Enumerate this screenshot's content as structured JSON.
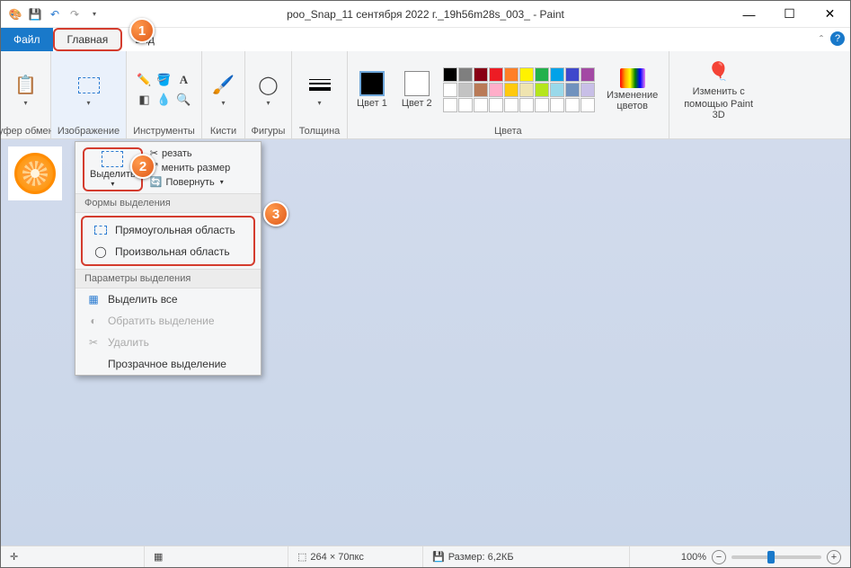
{
  "window": {
    "title_fragment": "poo_Snap_11 сентября 2022 г._19h56m28s_003_ - Paint"
  },
  "tabs": {
    "file": "Файл",
    "home": "Главная",
    "view": "Вид"
  },
  "ribbon": {
    "clipboard": {
      "label": "Буфер обмена"
    },
    "image": {
      "label": "Изображение"
    },
    "tools": {
      "label": "Инструменты"
    },
    "brushes": {
      "label": "Кисти"
    },
    "shapes": {
      "label": "Фигуры"
    },
    "thickness": {
      "label": "Толщина"
    },
    "color1": {
      "label": "Цвет 1"
    },
    "color2": {
      "label": "Цвет 2"
    },
    "colors_group": {
      "label": "Цвета"
    },
    "edit_colors": {
      "label": "Изменение цветов"
    },
    "paint3d": {
      "line1": "Изменить с",
      "line2": "помощью Paint 3D"
    }
  },
  "dropdown": {
    "select_btn": "Выделить",
    "crop": "резать",
    "resize": "менить размер",
    "rotate": "Повернуть",
    "section_shapes": "Формы выделения",
    "rect": "Прямоугольная область",
    "free": "Произвольная область",
    "section_params": "Параметры выделения",
    "select_all": "Выделить все",
    "invert": "Обратить выделение",
    "delete": "Удалить",
    "transparent": "Прозрачное выделение"
  },
  "status": {
    "dims": "264 × 70пкс",
    "size_label": "Размер: 6,2КБ",
    "zoom": "100%"
  },
  "callouts": {
    "c1": "1",
    "c2": "2",
    "c3": "3"
  },
  "palette_colors": [
    "#000000",
    "#7f7f7f",
    "#880015",
    "#ed1c24",
    "#ff7f27",
    "#fff200",
    "#22b14c",
    "#00a2e8",
    "#3f48cc",
    "#a349a4",
    "#ffffff",
    "#c3c3c3",
    "#b97a57",
    "#ffaec9",
    "#ffc90e",
    "#efe4b0",
    "#b5e61d",
    "#99d9ea",
    "#7092be",
    "#c8bfe7",
    "#ffffff",
    "#ffffff",
    "#ffffff",
    "#ffffff",
    "#ffffff",
    "#ffffff",
    "#ffffff",
    "#ffffff",
    "#ffffff",
    "#ffffff"
  ]
}
